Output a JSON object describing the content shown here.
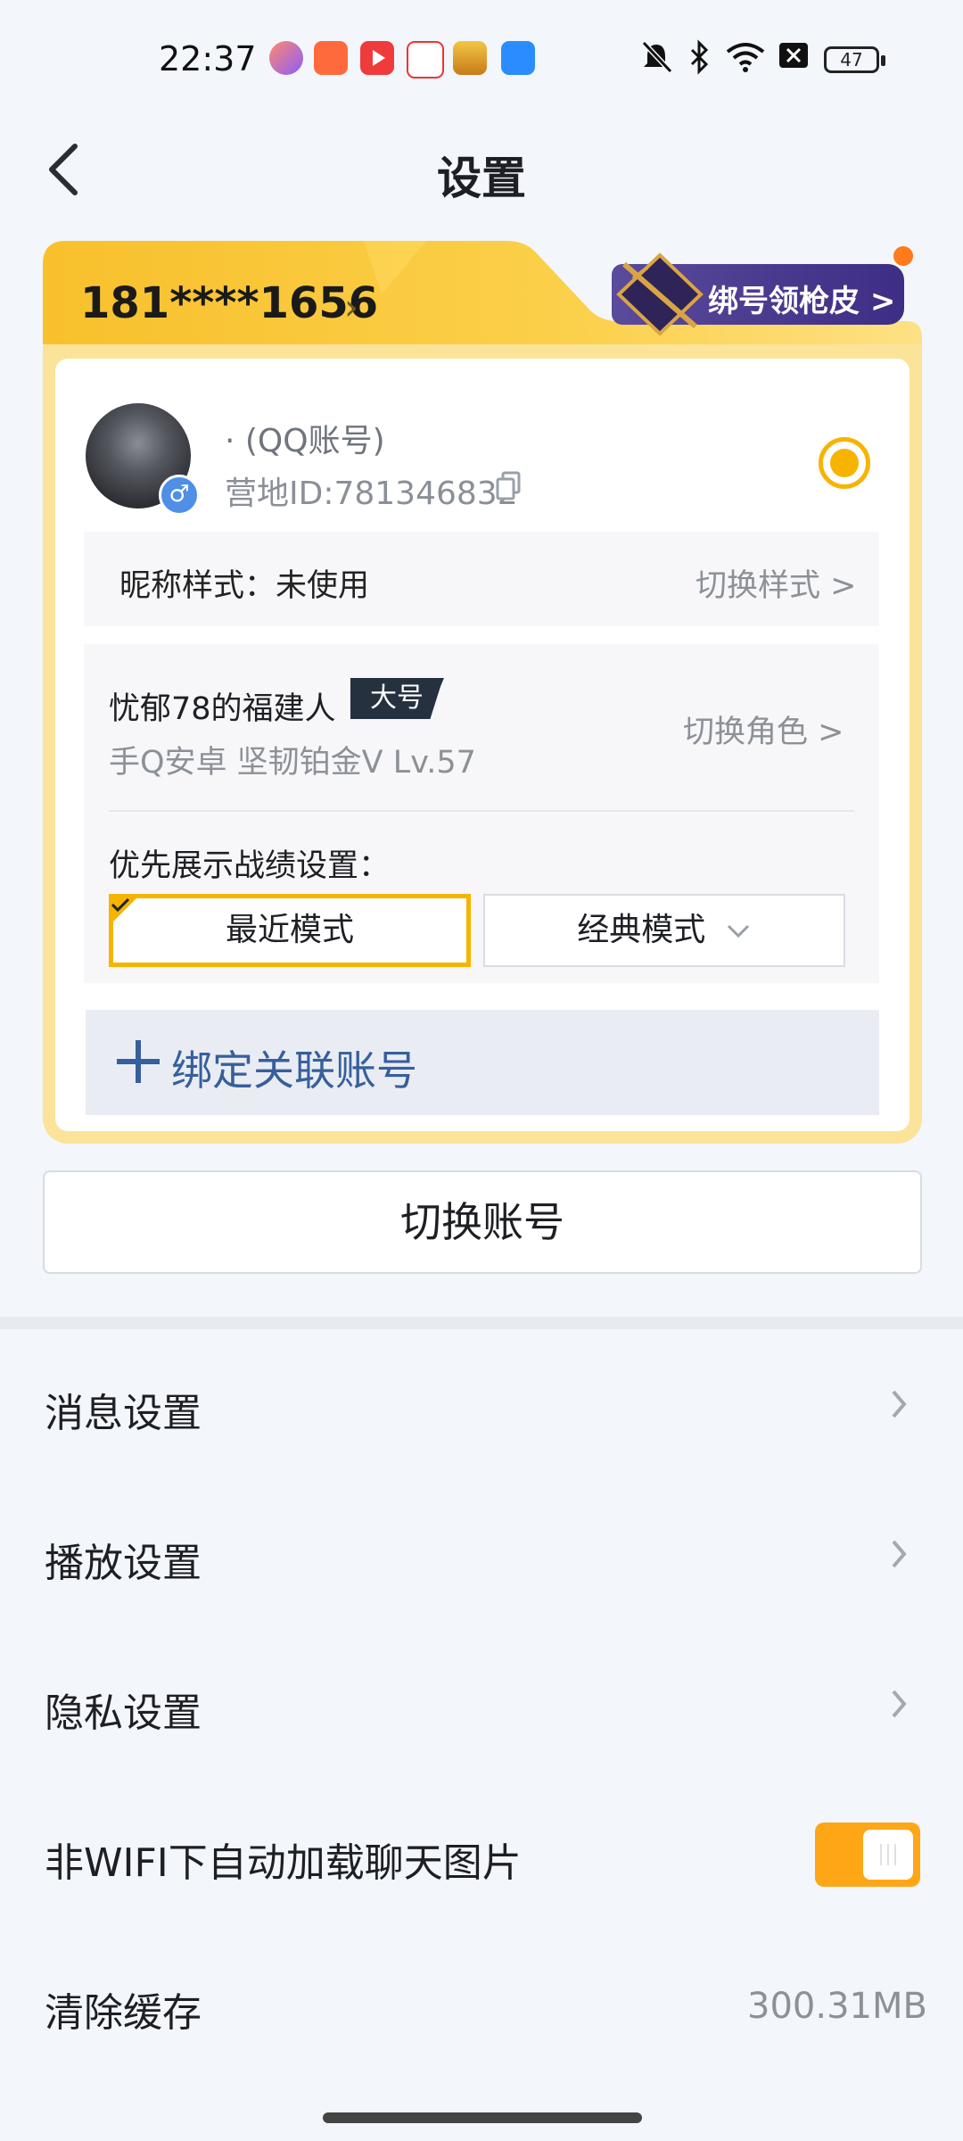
{
  "status_bar": {
    "time": "22:37",
    "battery": "47",
    "app_icons": [
      "game-center-icon",
      "gamepad-icon",
      "video-player-icon",
      "mall-icon",
      "peace-elite-icon",
      "files-icon"
    ],
    "system_icons": [
      "mute-bell-icon",
      "bluetooth-icon",
      "wifi-icon",
      "x-icon",
      "battery-icon"
    ]
  },
  "header": {
    "title": "设置",
    "back_icon": "chevron-left-icon"
  },
  "account_card": {
    "phone": "181****1656",
    "promo_label": "绑号领枪皮 >",
    "account_name": "· (QQ账号)",
    "camp_id": "营地ID:781346832",
    "gender_symbol": "♂",
    "nickname_style_label": "昵称样式：未使用",
    "nickname_switch": "切换样式 >",
    "role_name": "忧郁78的福建人",
    "role_tag": "大号",
    "role_meta": "手Q安卓  坚韧铂金V  Lv.57",
    "role_switch": "切换角色 >",
    "pref_label": "优先展示战绩设置：",
    "mode_recent": "最近模式",
    "mode_classic": "经典模式",
    "bind_label": "绑定关联账号"
  },
  "switch_account_label": "切换账号",
  "settings": {
    "message": "消息设置",
    "playback": "播放设置",
    "privacy": "隐私设置",
    "auto_load_images": "非WIFI下自动加载聊天图片",
    "auto_load_images_on": true,
    "clear_cache": "清除缓存",
    "cache_size": "300.31MB"
  },
  "colors": {
    "accent": "#f6b400",
    "toggle_on": "#ffa617",
    "link_blue": "#375f9c",
    "promo_purple": "#3d2d84"
  }
}
